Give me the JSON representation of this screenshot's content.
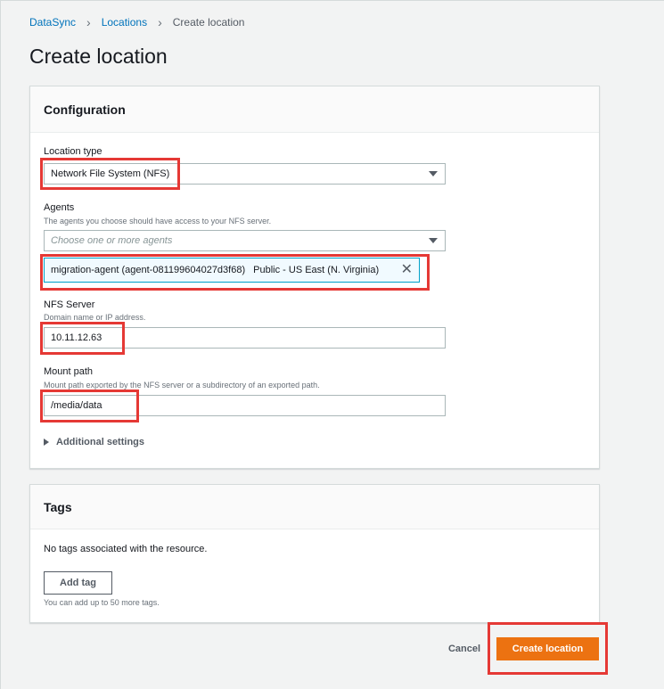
{
  "breadcrumb": {
    "item1": "DataSync",
    "item2": "Locations",
    "current": "Create location"
  },
  "page_title": "Create location",
  "configuration": {
    "title": "Configuration",
    "location_type": {
      "label": "Location type",
      "value": "Network File System (NFS)"
    },
    "agents": {
      "label": "Agents",
      "description": "The agents you choose should have access to your NFS server.",
      "placeholder": "Choose one or more agents",
      "selected_agent": "migration-agent (agent-081199604027d3f68)",
      "selected_agent_endpoint": "Public - US East (N. Virginia)"
    },
    "nfs_server": {
      "label": "NFS Server",
      "description": "Domain name or IP address.",
      "value": "10.11.12.63"
    },
    "mount_path": {
      "label": "Mount path",
      "description": "Mount path exported by the NFS server or a subdirectory of an exported path.",
      "value": "/media/data"
    },
    "additional_settings": "Additional settings"
  },
  "tags": {
    "title": "Tags",
    "empty_message": "No tags associated with the resource.",
    "add_tag": "Add tag",
    "hint": "You can add up to 50 more tags."
  },
  "actions": {
    "cancel": "Cancel",
    "create": "Create location"
  },
  "colors": {
    "primary": "#ec7211",
    "link": "#0073bb",
    "highlight": "#e53935",
    "token_border": "#00a1c9"
  },
  "icons": {
    "chevron": "chevron-right-icon",
    "caret": "caret-down-icon",
    "remove": "close-icon",
    "expand": "caret-right-icon"
  }
}
